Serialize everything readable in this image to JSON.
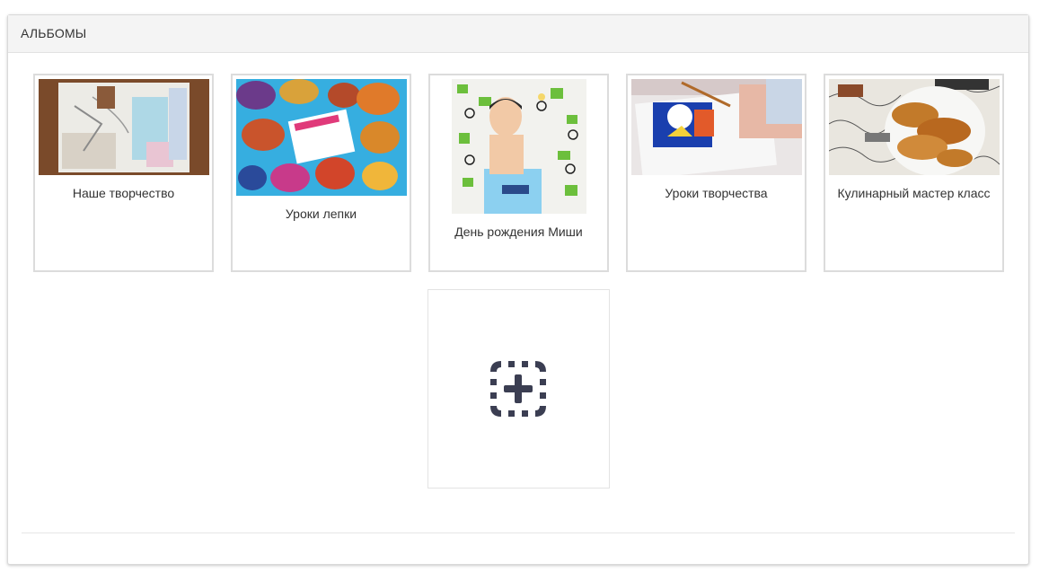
{
  "panel": {
    "title": "АЛЬБОМЫ"
  },
  "albums": [
    {
      "title": "Наше творчество"
    },
    {
      "title": "Уроки лепки"
    },
    {
      "title": "День рождения Миши"
    },
    {
      "title": "Уроки творчества"
    },
    {
      "title": "Кулинарный мастер класс"
    }
  ],
  "add_album": {
    "icon": "add-album-icon",
    "icon_color": "#3b3e52"
  },
  "colors": {
    "header_bg": "#f4f4f4",
    "card_border": "#dcdcdc",
    "text": "#333333"
  }
}
